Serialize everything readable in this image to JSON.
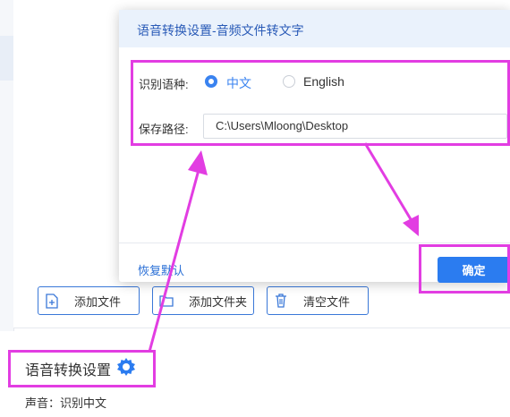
{
  "background": {
    "buttons": [
      {
        "label": "添加文件",
        "icon": "file-add-icon"
      },
      {
        "label": "添加文件夹",
        "icon": "folder-add-icon"
      },
      {
        "label": "清空文件",
        "icon": "trash-icon"
      }
    ],
    "settings_title": "语音转换设置",
    "voice_label": "声音：识别中文"
  },
  "dialog": {
    "title": "语音转换设置-音频文件转文字",
    "language_label": "识别语种:",
    "language_options": [
      {
        "label": "中文",
        "selected": true
      },
      {
        "label": "English",
        "selected": false
      }
    ],
    "path_label": "保存路径:",
    "path_value": "C:\\Users\\Mloong\\Desktop",
    "restore_label": "恢复默认",
    "confirm_label": "确定"
  },
  "colors": {
    "accent": "#2b7cf0",
    "annotation": "#e23de2",
    "header_bg": "#eaf2fc"
  }
}
